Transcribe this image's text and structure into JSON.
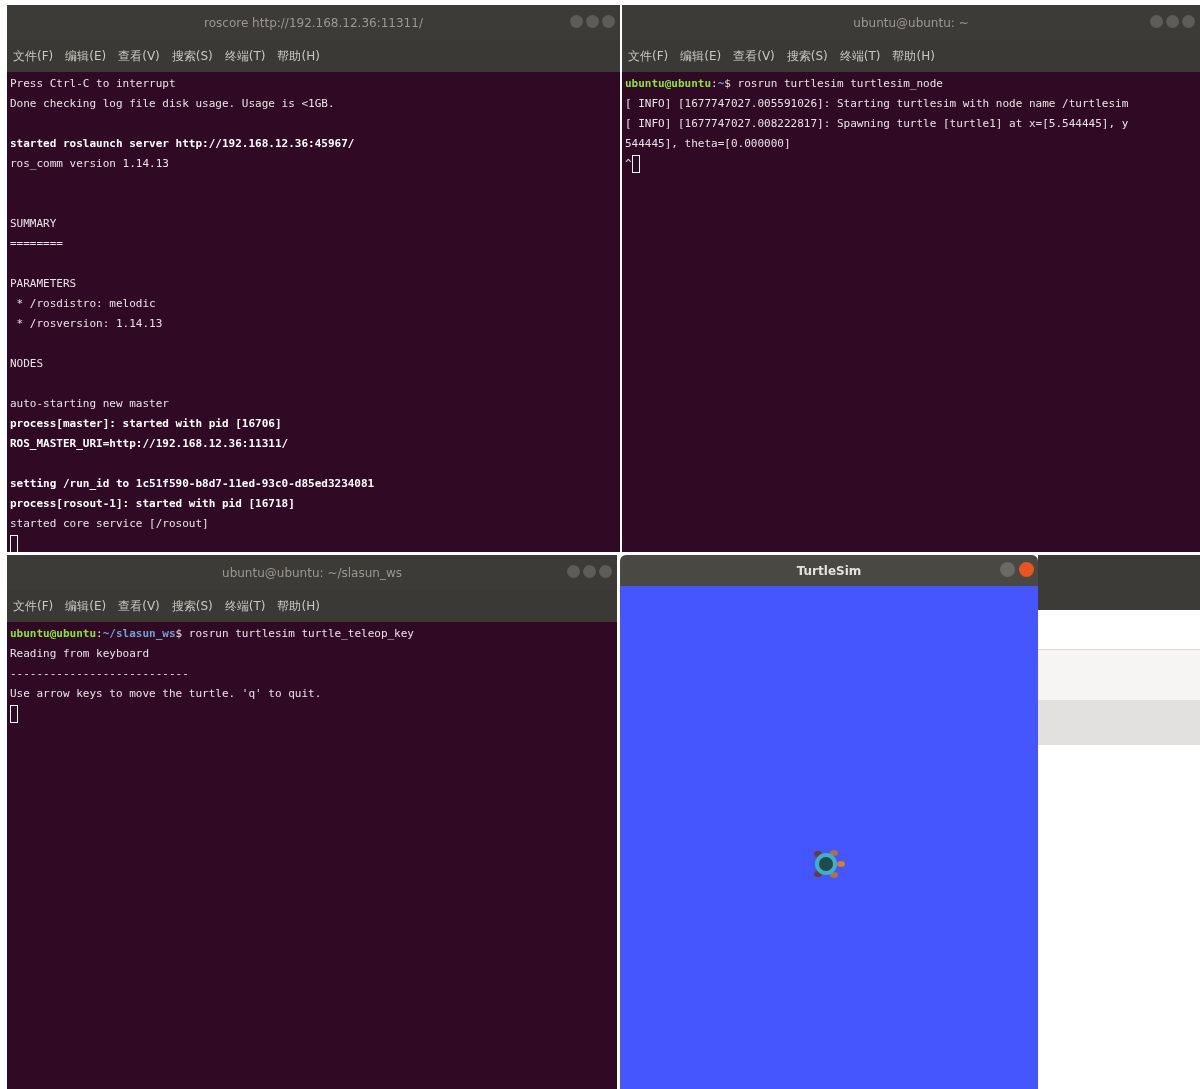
{
  "windows": [
    {
      "kind": "terminal",
      "title": "roscore http://192.168.12.36:11311/",
      "menu": [
        "文件(F)",
        "编辑(E)",
        "查看(V)",
        "搜索(S)",
        "终端(T)",
        "帮助(H)"
      ],
      "lines": [
        {
          "kind": "text",
          "text": "Press Ctrl-C to interrupt",
          "bold": false
        },
        {
          "kind": "text",
          "text": "Done checking log file disk usage. Usage is <1GB.",
          "bold": false
        },
        {
          "kind": "blank"
        },
        {
          "kind": "text",
          "text": "started roslaunch server http://192.168.12.36:45967/",
          "bold": true
        },
        {
          "kind": "text",
          "text": "ros_comm version 1.14.13",
          "bold": false
        },
        {
          "kind": "blank"
        },
        {
          "kind": "blank"
        },
        {
          "kind": "text",
          "text": "SUMMARY",
          "bold": false
        },
        {
          "kind": "text",
          "text": "========",
          "bold": false
        },
        {
          "kind": "blank"
        },
        {
          "kind": "text",
          "text": "PARAMETERS",
          "bold": false
        },
        {
          "kind": "text",
          "text": " * /rosdistro: melodic",
          "bold": false
        },
        {
          "kind": "text",
          "text": " * /rosversion: 1.14.13",
          "bold": false
        },
        {
          "kind": "blank"
        },
        {
          "kind": "text",
          "text": "NODES",
          "bold": false
        },
        {
          "kind": "blank"
        },
        {
          "kind": "text",
          "text": "auto-starting new master",
          "bold": false
        },
        {
          "kind": "text",
          "text": "process[master]: started with pid [16706]",
          "bold": true
        },
        {
          "kind": "text",
          "text": "ROS_MASTER_URI=http://192.168.12.36:11311/",
          "bold": true
        },
        {
          "kind": "blank"
        },
        {
          "kind": "text",
          "text": "setting /run_id to 1c51f590-b8d7-11ed-93c0-d85ed3234081",
          "bold": true
        },
        {
          "kind": "text",
          "text": "process[rosout-1]: started with pid [16718]",
          "bold": true
        },
        {
          "kind": "text",
          "text": "started core service [/rosout]",
          "bold": false
        },
        {
          "kind": "cursor"
        }
      ]
    },
    {
      "kind": "terminal",
      "title": "ubuntu@ubuntu: ~",
      "menu": [
        "文件(F)",
        "编辑(E)",
        "查看(V)",
        "搜索(S)",
        "终端(T)",
        "帮助(H)"
      ],
      "lines": [
        {
          "kind": "prompt",
          "user": "ubuntu@ubuntu",
          "separator": ":",
          "path": "~",
          "command": "$ rosrun turtlesim turtlesim_node"
        },
        {
          "kind": "text",
          "text": "[ INFO] [1677747027.005591026]: Starting turtlesim with node name /turtlesim",
          "bold": false
        },
        {
          "kind": "text",
          "text": "[ INFO] [1677747027.008222817]: Spawning turtle [turtle1] at x=[5.544445], y",
          "bold": false
        },
        {
          "kind": "text",
          "text": "544445], theta=[0.000000]",
          "bold": false
        },
        {
          "kind": "cursor",
          "text": "^"
        }
      ]
    },
    {
      "kind": "terminal",
      "title": "ubuntu@ubuntu: ~/slasun_ws",
      "menu": [
        "文件(F)",
        "编辑(E)",
        "查看(V)",
        "搜索(S)",
        "终端(T)",
        "帮助(H)"
      ],
      "lines": [
        {
          "kind": "prompt",
          "user": "ubuntu@ubuntu",
          "separator": ":",
          "path": "~/slasun_ws",
          "command": "$ rosrun turtlesim turtle_teleop_key"
        },
        {
          "kind": "text",
          "text": "Reading from keyboard",
          "bold": false
        },
        {
          "kind": "text",
          "text": "---------------------------",
          "bold": false
        },
        {
          "kind": "text",
          "text": "Use arrow keys to move the turtle. 'q' to quit.",
          "bold": false
        },
        {
          "kind": "cursor"
        }
      ]
    },
    {
      "kind": "blank_window"
    },
    {
      "kind": "turtlesim",
      "title": "TurtleSim"
    }
  ]
}
